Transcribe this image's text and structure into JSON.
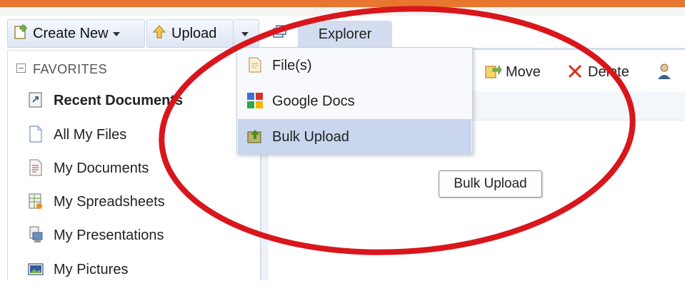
{
  "toolbar": {
    "create_new_label": "Create New",
    "upload_label": "Upload"
  },
  "tabs": {
    "explorer_label": "Explorer"
  },
  "actions": {
    "move_label": "Move",
    "delete_label": "Delete"
  },
  "sidebar": {
    "header": "FAVORITES",
    "items": [
      {
        "label": "Recent Documents",
        "icon": "recent-documents-icon"
      },
      {
        "label": "All My Files",
        "icon": "file-icon"
      },
      {
        "label": "My Documents",
        "icon": "document-icon"
      },
      {
        "label": "My Spreadsheets",
        "icon": "spreadsheet-icon"
      },
      {
        "label": "My Presentations",
        "icon": "presentation-icon"
      },
      {
        "label": "My Pictures",
        "icon": "picture-icon"
      }
    ]
  },
  "upload_menu": {
    "items": [
      {
        "label": "File(s)",
        "icon": "file-icon"
      },
      {
        "label": "Google Docs",
        "icon": "google-docs-icon"
      },
      {
        "label": "Bulk Upload",
        "icon": "bulk-upload-icon",
        "selected": true
      }
    ]
  },
  "tooltip": {
    "text": "Bulk Upload"
  },
  "colors": {
    "accent_bar": "#e8762f",
    "tab_bg": "#d3ddef",
    "menu_highlight": "#c9d6ee",
    "annotation_ellipse": "#d8161c"
  }
}
